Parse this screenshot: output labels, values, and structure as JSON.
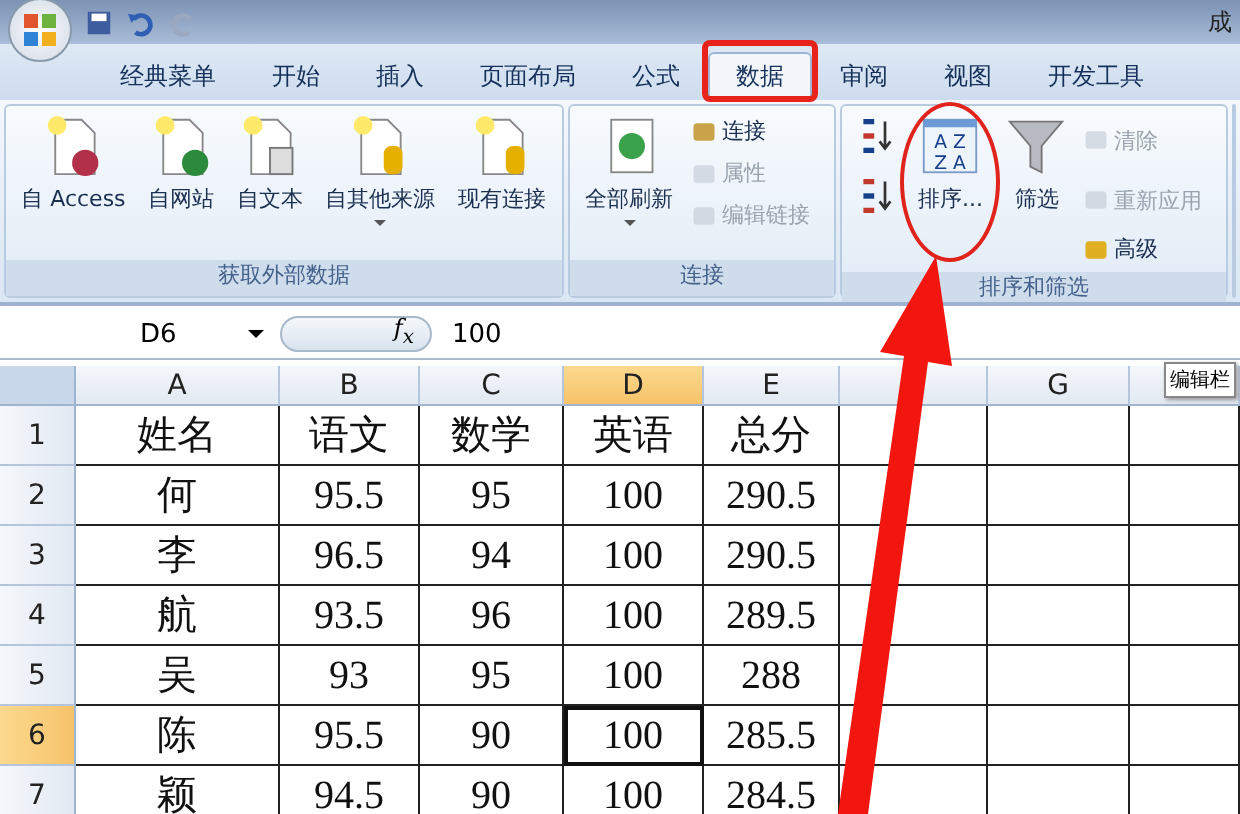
{
  "title_bar": {
    "title": "成"
  },
  "tabs": [
    {
      "label": "经典菜单",
      "selected": false
    },
    {
      "label": "开始",
      "selected": false
    },
    {
      "label": "插入",
      "selected": false
    },
    {
      "label": "页面布局",
      "selected": false
    },
    {
      "label": "公式",
      "selected": false
    },
    {
      "label": "数据",
      "selected": true
    },
    {
      "label": "审阅",
      "selected": false
    },
    {
      "label": "视图",
      "selected": false
    },
    {
      "label": "开发工具",
      "selected": false
    }
  ],
  "ribbon_groups": [
    {
      "label": "获取外部数据",
      "buttons": [
        {
          "kind": "large",
          "label": "自 Access",
          "disabled": false
        },
        {
          "kind": "large",
          "label": "自网站",
          "disabled": false
        },
        {
          "kind": "large",
          "label": "自文本",
          "disabled": false
        },
        {
          "kind": "large",
          "label": "自其他来源",
          "disabled": false,
          "dropdown": true
        },
        {
          "kind": "large",
          "label": "现有连接",
          "disabled": false
        }
      ]
    },
    {
      "label": "连接",
      "buttons": [
        {
          "kind": "large",
          "label": "全部刷新",
          "disabled": false,
          "dropdown": true
        },
        {
          "kind": "small",
          "label": "连接",
          "disabled": false
        },
        {
          "kind": "small",
          "label": "属性",
          "disabled": true
        },
        {
          "kind": "small",
          "label": "编辑链接",
          "disabled": true
        }
      ]
    },
    {
      "label": "排序和筛选",
      "buttons": [
        {
          "kind": "tiny",
          "disabled": false
        },
        {
          "kind": "tiny",
          "disabled": false
        },
        {
          "kind": "large",
          "label": "排序...",
          "letters": [
            "A Z",
            "Z A"
          ],
          "disabled": false
        },
        {
          "kind": "large",
          "label": "筛选",
          "disabled": false
        },
        {
          "kind": "small",
          "label": "清除",
          "disabled": true
        },
        {
          "kind": "small",
          "label": "重新应用",
          "disabled": true
        },
        {
          "kind": "small",
          "label": "高级",
          "disabled": false
        }
      ]
    }
  ],
  "formula_bar": {
    "name_box": "D6",
    "function_label": "f$_{x}$",
    "value": "100",
    "tooltip": "编辑栏"
  },
  "columns": [
    {
      "label": "A",
      "selected": false
    },
    {
      "label": "B",
      "selected": false
    },
    {
      "label": "C",
      "selected": false
    },
    {
      "label": "D",
      "selected": true
    },
    {
      "label": "E",
      "selected": false
    },
    {
      "selected": false
    },
    {
      "label": "G",
      "selected": false
    }
  ],
  "rows": [
    {
      "number": "1",
      "selected": false,
      "cells": [
        "姓名",
        "语文",
        "数学",
        "英语",
        "总分"
      ]
    },
    {
      "number": "2",
      "selected": false,
      "cells": [
        "何",
        "95.5",
        "95",
        "100",
        "290.5"
      ]
    },
    {
      "number": "3",
      "selected": false,
      "cells": [
        "李",
        "96.5",
        "94",
        "100",
        "290.5"
      ]
    },
    {
      "number": "4",
      "selected": false,
      "cells": [
        "航",
        "93.5",
        "96",
        "100",
        "289.5"
      ]
    },
    {
      "number": "5",
      "selected": false,
      "cells": [
        "吴",
        "93",
        "95",
        "100",
        "288"
      ]
    },
    {
      "number": "6",
      "selected": true,
      "cells": [
        "陈",
        "95.5",
        "90",
        "100",
        "285.5"
      ]
    },
    {
      "number": "7",
      "selected": false,
      "cells": [
        "颖",
        "94.5",
        "90",
        "100",
        "284.5"
      ]
    }
  ]
}
